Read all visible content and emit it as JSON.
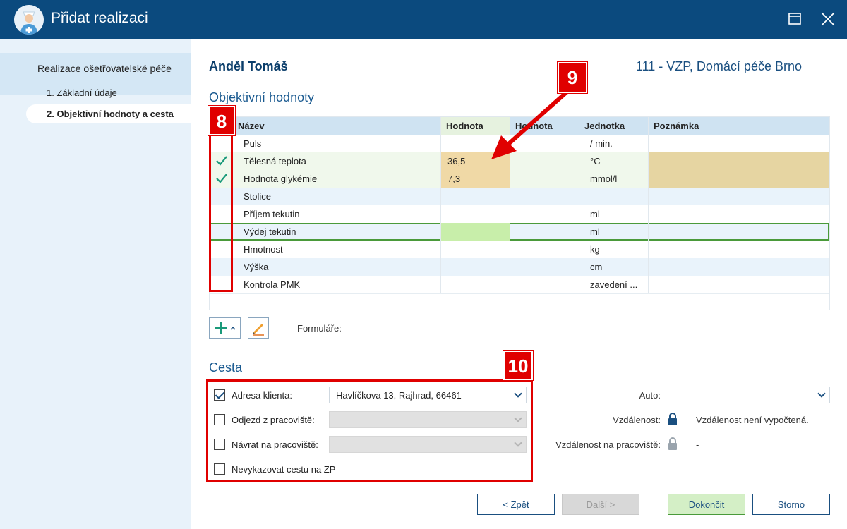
{
  "window": {
    "title": "Přidat realizaci",
    "icons": {
      "app": "nurse-icon",
      "maximize": "maximize-icon",
      "close": "close-icon"
    }
  },
  "sidebar": {
    "title": "Realizace ošetřovatelské péče",
    "steps": [
      {
        "label": "1. Základní údaje",
        "active": false
      },
      {
        "label": "2. Objektivní hodnoty a cesta",
        "active": true
      }
    ]
  },
  "header": {
    "patient": "Anděl Tomáš",
    "insurer": "111 - VZP, Domácí péče Brno"
  },
  "objective": {
    "title": "Objektivní hodnoty",
    "columns": [
      "Název",
      "Hodnota",
      "Hodnota",
      "Jednotka",
      "Poznámka"
    ],
    "rows": [
      {
        "checked": false,
        "name": "Puls",
        "value": "",
        "value2": "",
        "unit": "/ min.",
        "note": ""
      },
      {
        "checked": true,
        "name": "Tělesná teplota",
        "value": "36,5",
        "value2": "",
        "unit": "°C",
        "note": ""
      },
      {
        "checked": true,
        "name": "Hodnota glykémie",
        "value": "7,3",
        "value2": "",
        "unit": "mmol/l",
        "note": ""
      },
      {
        "checked": false,
        "name": "Stolice",
        "value": "",
        "value2": "",
        "unit": "",
        "note": ""
      },
      {
        "checked": false,
        "name": "Příjem tekutin",
        "value": "",
        "value2": "",
        "unit": "ml",
        "note": ""
      },
      {
        "checked": false,
        "name": "Výdej tekutin",
        "value": "",
        "value2": "",
        "unit": "ml",
        "note": ""
      },
      {
        "checked": false,
        "name": "Hmotnost",
        "value": "",
        "value2": "",
        "unit": "kg",
        "note": ""
      },
      {
        "checked": false,
        "name": "Výška",
        "value": "",
        "value2": "",
        "unit": "cm",
        "note": ""
      },
      {
        "checked": false,
        "name": "Kontrola PMK",
        "value": "",
        "value2": "",
        "unit": "zavedení ...",
        "note": ""
      }
    ],
    "toolbar": {
      "add_icon": "plus-icon",
      "edit_icon": "pencil-icon",
      "forms_label": "Formuláře:"
    }
  },
  "route": {
    "title": "Cesta",
    "client_address": {
      "label": "Adresa klienta:",
      "checked": true,
      "value": "Havlíčkova 13, Rajhrad, 66461"
    },
    "depart": {
      "label": "Odjezd z pracoviště:",
      "checked": false,
      "value": ""
    },
    "return": {
      "label": "Návrat na pracoviště:",
      "checked": false,
      "value": ""
    },
    "no_report": {
      "label": "Nevykazovat cestu na ZP",
      "checked": false
    },
    "car": {
      "label": "Auto:",
      "value": ""
    },
    "distance": {
      "label": "Vzdálenost:",
      "value": "Vzdálenost není vypočtená."
    },
    "distance_workplace": {
      "label": "Vzdálenost na pracoviště:",
      "value": "-"
    }
  },
  "buttons": {
    "back": "< Zpět",
    "next": "Další >",
    "finish": "Dokončit",
    "cancel": "Storno"
  },
  "callouts": {
    "rows_marker": "8",
    "value_arrow": "9",
    "route_marker": "10"
  },
  "colors": {
    "titlebar": "#0b4a7e",
    "accent": "#1a4f80",
    "callout": "#e00000",
    "check": "#1a9a7a"
  }
}
